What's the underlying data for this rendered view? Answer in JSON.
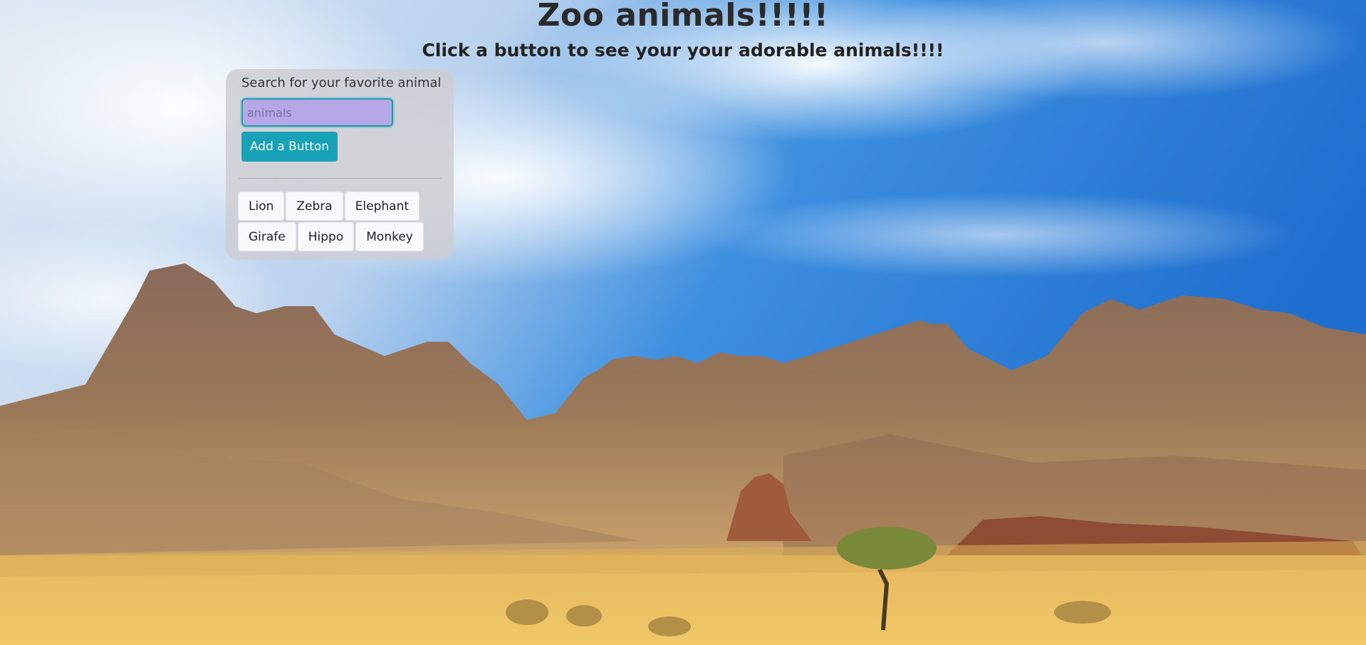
{
  "page": {
    "title": "Zoo animals!!!!!",
    "subtitle": "Click a button to see your your adorable animals!!!!"
  },
  "search_panel": {
    "label": "Search for your favorite animal",
    "input_value": "",
    "input_placeholder": "animals",
    "add_button_label": "Add a Button"
  },
  "animal_buttons": [
    [
      "Lion",
      "Zebra",
      "Elephant"
    ],
    [
      "Girafe",
      "Hippo",
      "Monkey"
    ]
  ],
  "colors": {
    "accent": "#17a2b8",
    "input_background": "#b6a8e6",
    "panel_background": "#cdcdd2",
    "button_background": "#f8f9fa"
  },
  "background": {
    "description_icon": "desert-mountains-landscape"
  }
}
